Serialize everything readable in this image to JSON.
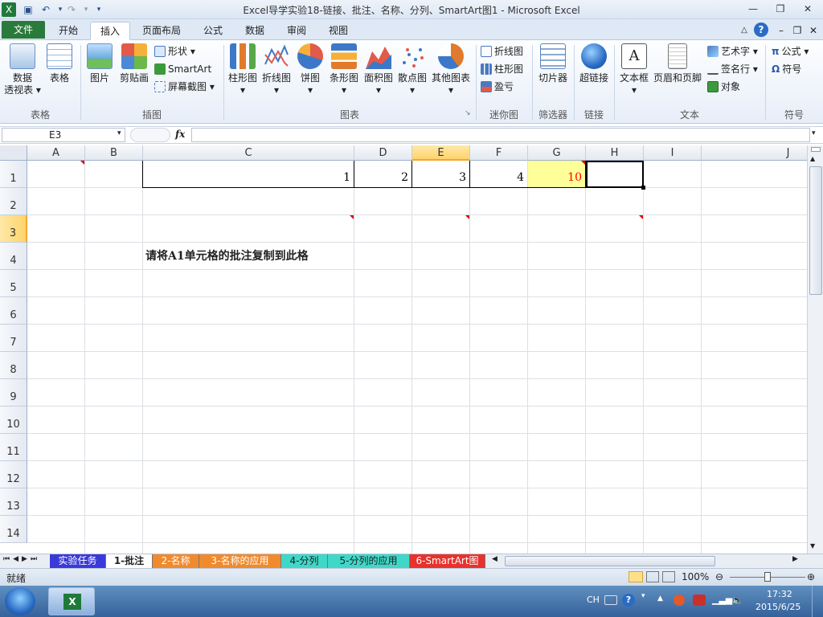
{
  "window": {
    "title": "Excel导学实验18-链接、批注、名称、分列、SmartArt图1 - Microsoft Excel",
    "min": "—",
    "restore": "❐",
    "close": "✕"
  },
  "tabs": [
    {
      "label": "文件"
    },
    {
      "label": "开始"
    },
    {
      "label": "插入"
    },
    {
      "label": "页面布局"
    },
    {
      "label": "公式"
    },
    {
      "label": "数据"
    },
    {
      "label": "审阅"
    },
    {
      "label": "视图"
    }
  ],
  "ribbon": {
    "pivot_l1": "数据",
    "pivot_l2": "透视表 ▾",
    "table": "表格",
    "group_table": "表格",
    "picture": "图片",
    "clipart": "剪贴画",
    "shapes": "形状 ▾",
    "smartart": "SmartArt",
    "screenshot": "屏幕截图 ▾",
    "group_illus": "插图",
    "bar": "柱形图",
    "line": "折线图",
    "pie": "饼图",
    "hbar": "条形图",
    "area": "面积图",
    "scatter": "散点图",
    "other": "其他图表",
    "group_chart": "图表",
    "sp_line": "折线图",
    "sp_col": "柱形图",
    "sp_wl": "盈亏",
    "group_spark": "迷你图",
    "slicer": "切片器",
    "group_filter": "筛选器",
    "hyperlink": "超链接",
    "group_link": "链接",
    "textbox": "文本框",
    "header": "页眉和页脚",
    "wordart": "艺术字 ▾",
    "signature": "签名行 ▾",
    "object": "对象",
    "group_text": "文本",
    "equation": "公式 ▾",
    "symbol": "符号",
    "group_symbol": "符号",
    "drop": "▾"
  },
  "formula": {
    "namebox": "E3",
    "fx": "fx",
    "value": ""
  },
  "columns": [
    "A",
    "B",
    "C",
    "D",
    "E",
    "F",
    "G",
    "H",
    "I",
    "J"
  ],
  "rows": [
    "1",
    "2",
    "3",
    "4",
    "5",
    "6",
    "7",
    "8",
    "9",
    "10",
    "11",
    "12",
    "13",
    "14"
  ],
  "cells": {
    "C1": "1",
    "D1": "2",
    "E1": "3",
    "F1": "4",
    "G1": "10",
    "C4": "请将A1单元格的批注复制到此格"
  },
  "sheets": [
    {
      "label": "实验任务"
    },
    {
      "label": "1-批注"
    },
    {
      "label": "2-名称"
    },
    {
      "label": "3-名称的应用"
    },
    {
      "label": "4-分列"
    },
    {
      "label": "5-分列的应用"
    },
    {
      "label": "6-SmartArt图"
    }
  ],
  "status": {
    "ready": "就绪",
    "zoom": "100%"
  },
  "taskbar": {
    "lang": "CH",
    "time": "17:32",
    "date": "2015/6/25"
  },
  "colors": {
    "accent": "#2a7a3c",
    "selection": "#ffe68a",
    "comment": "#d00000",
    "g1_fill": "#ffff99",
    "g1_text": "#ff0000"
  }
}
